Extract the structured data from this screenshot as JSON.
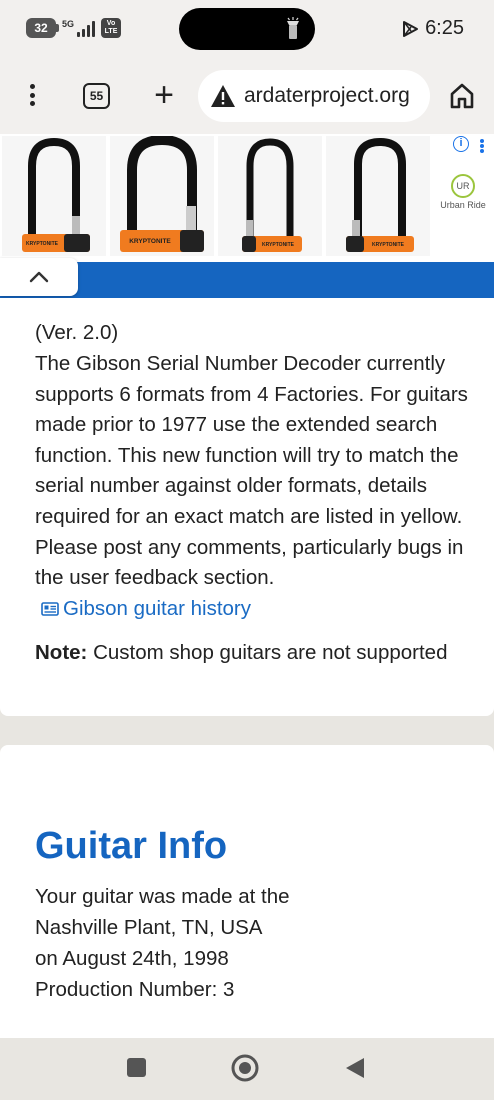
{
  "status_bar": {
    "battery": "32",
    "network": "5G",
    "volte_top": "Vo",
    "volte_bottom": "LTE",
    "time": "6:25"
  },
  "browser": {
    "tab_count": "55",
    "url": "ardaterproject.org",
    "menu_icon": "more-vert-icon",
    "new_tab_icon": "plus-icon",
    "security_icon": "warning-icon",
    "home_icon": "home-icon"
  },
  "ad": {
    "info_label": "i",
    "brand_logo": "UR",
    "brand_name": "Urban Ride",
    "products": [
      "KRYPTONITE",
      "KRYPTONITE",
      "KRYPTONITE",
      "KRYPTONITE"
    ],
    "accent_color": "#1565c0",
    "lock_color": "#f07b1f"
  },
  "intro": {
    "version": "(Ver. 2.0)",
    "description": "The Gibson Serial Number Decoder currently supports 6 formats from 4 Factories. For guitars made prior to 1977 use the extended search function. This new function will try to match the serial number against older formats, details required for an exact match are listed in yellow. Please post any comments, particularly bugs in the user feedback section.",
    "history_link": "Gibson guitar history",
    "note_label": "Note:",
    "note_text": " Custom shop guitars are not supported"
  },
  "guitar_info": {
    "title": "Guitar Info",
    "line1": "Your guitar was made at the",
    "line2": "Nashville Plant, TN, USA",
    "line3": "on August 24th, 1998",
    "line4": "Production Number: 3"
  },
  "colors": {
    "link": "#1a6bc4",
    "heading": "#1565c0"
  }
}
